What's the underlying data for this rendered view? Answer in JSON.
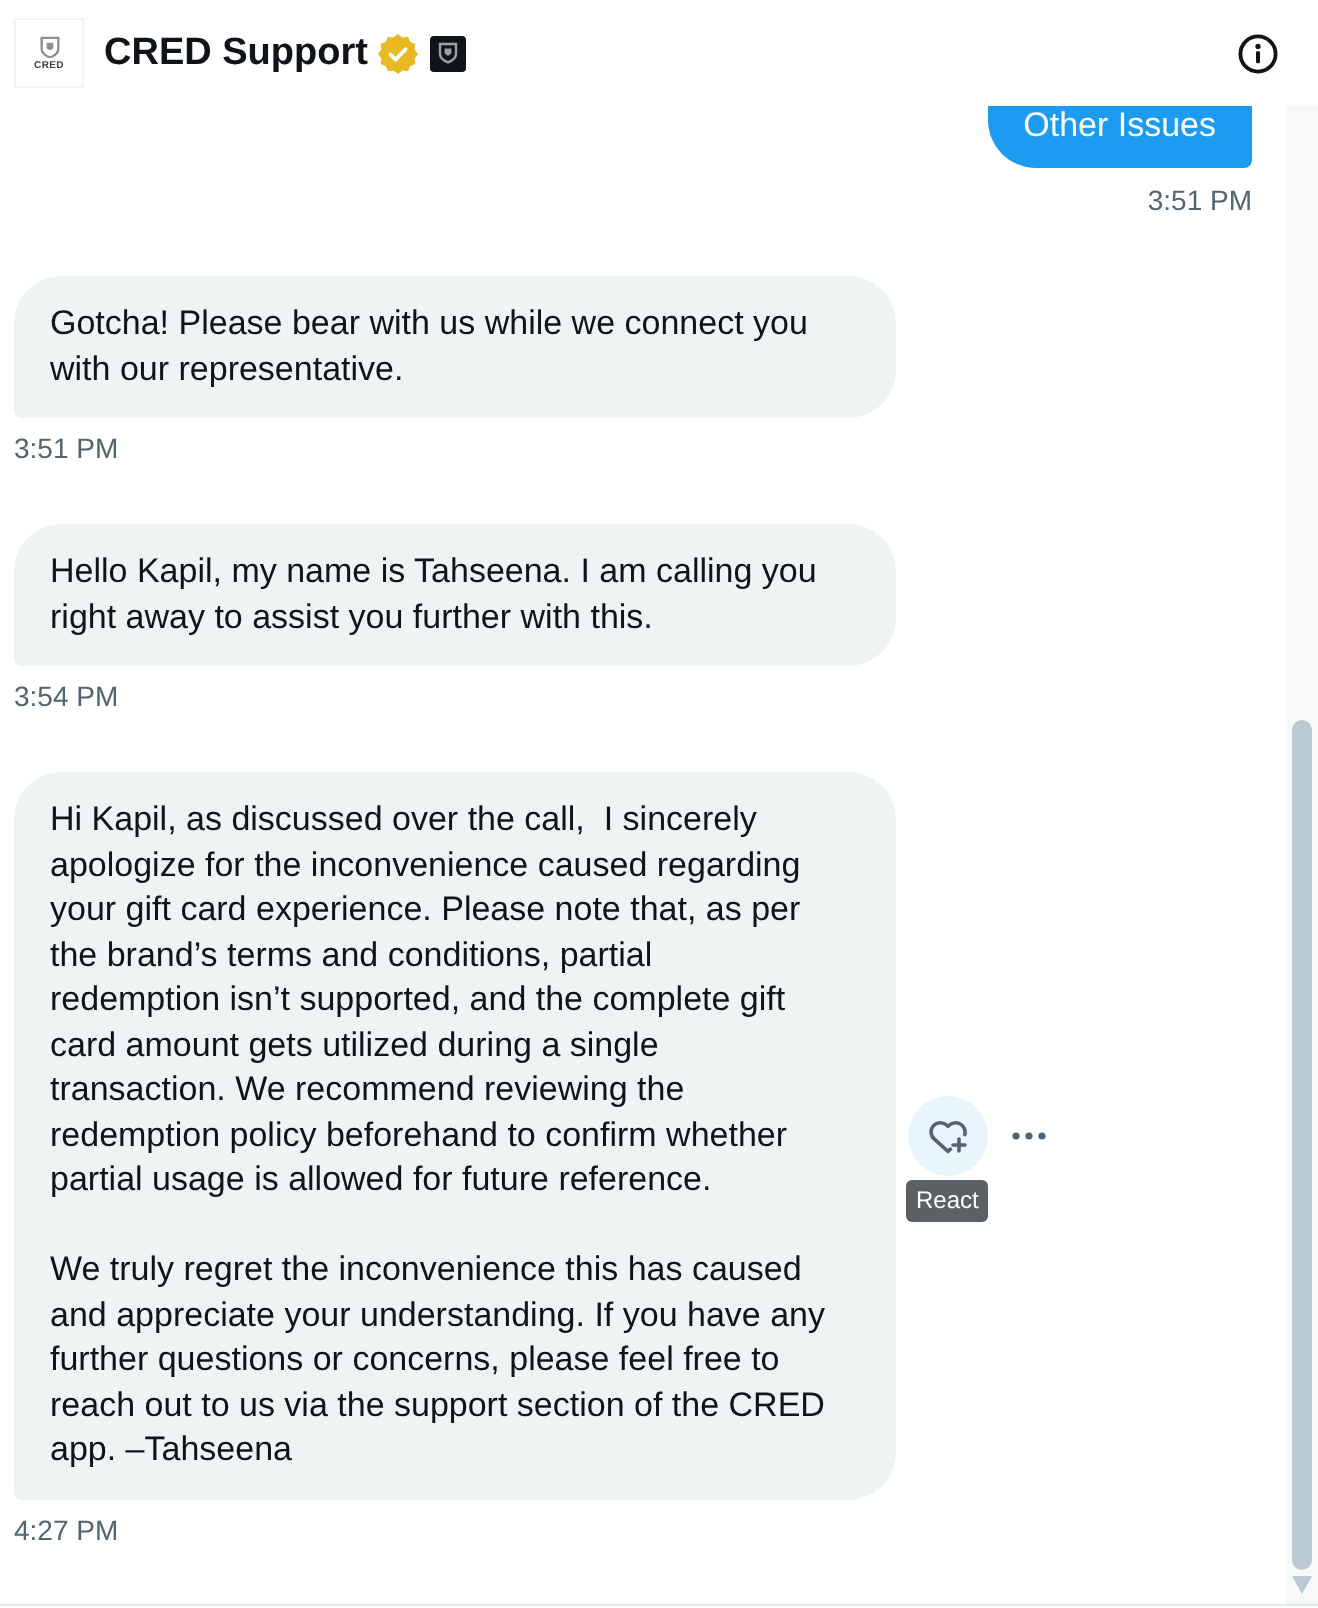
{
  "header": {
    "avatar_label": "CRED",
    "title": "CRED Support",
    "verified": true
  },
  "messages": [
    {
      "kind": "sent",
      "text": "Other Issues",
      "time": "3:51 PM",
      "hovered": false
    },
    {
      "kind": "received",
      "text": "Gotcha! Please bear with us while we connect you with our representative.",
      "time": "3:51 PM",
      "hovered": false
    },
    {
      "kind": "received",
      "text": "Hello Kapil, my name is Tahseena. I am calling you right away to assist you further with this.",
      "time": "3:54 PM",
      "hovered": false
    },
    {
      "kind": "received",
      "text": "Hi Kapil, as discussed over the call,  I sincerely apologize for the inconvenience caused regarding your gift card experience. Please note that, as per the brand’s terms and conditions, partial redemption isn’t supported, and the complete gift card amount gets utilized during a single transaction. We recommend reviewing the redemption policy beforehand to confirm whether partial usage is allowed for future reference.\n\nWe truly regret the inconvenience this has caused and appreciate your understanding. If you have any further questions or concerns, please feel free to reach out to us via the support section of the CRED app. –Tahseena",
      "time": "4:27 PM",
      "hovered": true
    }
  ],
  "hover_tooltip": "React"
}
